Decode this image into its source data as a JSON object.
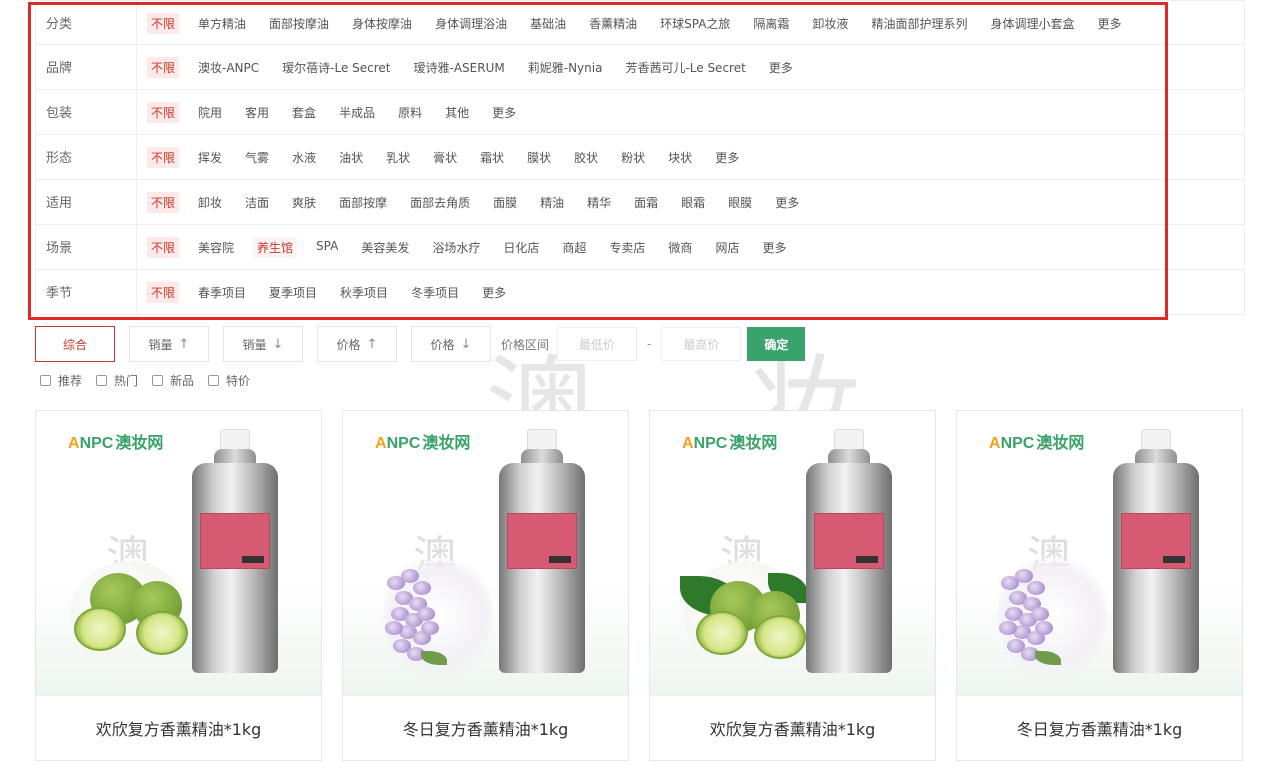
{
  "filters": [
    {
      "label": "分类",
      "options": [
        "不限",
        "单方精油",
        "面部按摩油",
        "身体按摩油",
        "身体调理浴油",
        "基础油",
        "香薰精油",
        "环球SPA之旅",
        "隔离霜",
        "卸妆液",
        "精油面部护理系列",
        "身体调理小套盒",
        "更多"
      ]
    },
    {
      "label": "品牌",
      "options": [
        "不限",
        "澳妆-ANPC",
        "瑷尔蓓诗-Le Secret",
        "瑷诗雅-ASERUM",
        "莉妮雅-Nynia",
        "芳香茜可儿-Le Secret",
        "更多"
      ]
    },
    {
      "label": "包装",
      "options": [
        "不限",
        "院用",
        "客用",
        "套盒",
        "半成品",
        "原料",
        "其他",
        "更多"
      ]
    },
    {
      "label": "形态",
      "options": [
        "不限",
        "挥发",
        "气雾",
        "水液",
        "油状",
        "乳状",
        "膏状",
        "霜状",
        "膜状",
        "胶状",
        "粉状",
        "块状",
        "更多"
      ]
    },
    {
      "label": "适用",
      "options": [
        "不限",
        "卸妆",
        "洁面",
        "爽肤",
        "面部按摩",
        "面部去角质",
        "面膜",
        "精油",
        "精华",
        "面霜",
        "眼霜",
        "眼膜",
        "更多"
      ]
    },
    {
      "label": "场景",
      "options": [
        "不限",
        "美容院",
        "养生馆",
        "SPA",
        "美容美发",
        "浴场水疗",
        "日化店",
        "商超",
        "专卖店",
        "微商",
        "网店",
        "更多"
      ]
    },
    {
      "label": "季节",
      "options": [
        "不限",
        "春季项目",
        "夏季项目",
        "秋季项目",
        "冬季项目",
        "更多"
      ]
    }
  ],
  "sort": {
    "comprehensive": "综合",
    "sales_up": "销量",
    "sales_down": "销量",
    "price_up": "价格",
    "price_down": "价格",
    "arrow_up": "↑",
    "arrow_down": "↓",
    "price_range_label": "价格区间",
    "min_placeholder": "最低价",
    "dash": "-",
    "max_placeholder": "最高价",
    "confirm": "确定"
  },
  "checkboxes": [
    "推荐",
    "热门",
    "新品",
    "特价"
  ],
  "watermark": "澳 妆",
  "image_watermark": "澳 妆",
  "logo": {
    "a": "A",
    "npc": "NPC",
    "cn": "澳妆网"
  },
  "products": [
    {
      "title": "欢欣复方香薰精油*1kg",
      "image": "lime"
    },
    {
      "title": "冬日复方香薰精油*1kg",
      "image": "flower"
    },
    {
      "title": "欢欣复方香薰精油*1kg",
      "image": "lime-leaf"
    },
    {
      "title": "冬日复方香薰精油*1kg",
      "image": "flower"
    }
  ],
  "colors": {
    "accent_red": "#d0352a",
    "confirm_green": "#3aa26b",
    "highlight_frame": "#e02a2a"
  }
}
